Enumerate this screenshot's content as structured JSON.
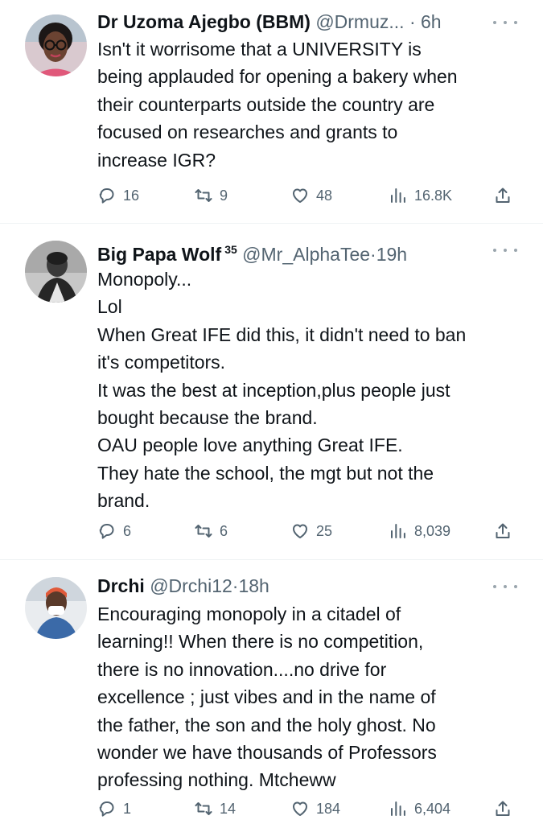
{
  "tweets": [
    {
      "name": "Dr Uzoma Ajegbo (BBM)",
      "badge": "",
      "handle": "@Drmuz...",
      "separator": "·",
      "time": "6h",
      "lines": [
        "Isn't it worrisome that a UNIVERSITY is",
        "being  applauded for opening a bakery when",
        "their counterparts outside the country are",
        "focused on researches and grants to",
        "increase IGR?"
      ],
      "replies": "16",
      "retweets": "9",
      "likes": "48",
      "views": "16.8K"
    },
    {
      "name": "Big Papa Wolf",
      "badge": "35",
      "handle": "@Mr_AlphaTee",
      "separator": "·",
      "time": "19h",
      "lines": [
        "Monopoly...",
        "Lol",
        "When Great IFE did this, it didn't need to ban",
        "it's competitors.",
        "It was the best at inception,plus people just",
        "bought because the brand.",
        "OAU people love anything Great IFE.",
        "They hate the school, the mgt but not the",
        "brand."
      ],
      "replies": "6",
      "retweets": "6",
      "likes": "25",
      "views": "8,039"
    },
    {
      "name": "Drchi",
      "badge": "",
      "handle": "@Drchi12",
      "separator": "·",
      "time": "18h",
      "lines": [
        "Encouraging monopoly in a citadel of",
        "learning!! When there is no competition,",
        "there is no innovation....no drive for",
        "excellence ; just vibes and in the name of",
        "the father, the son and the holy ghost. No",
        "wonder we have thousands of Professors",
        "professing nothing. Mtcheww"
      ],
      "replies": "1",
      "retweets": "14",
      "likes": "184",
      "views": "6,404"
    }
  ],
  "icons": {
    "reply": "reply-icon",
    "retweet": "retweet-icon",
    "like": "heart-icon",
    "views": "views-chart-icon",
    "share": "share-icon",
    "more": "more-dots-icon"
  },
  "colors": {
    "text": "#0f1419",
    "secondary": "#536471",
    "divider": "#eff3f4"
  }
}
